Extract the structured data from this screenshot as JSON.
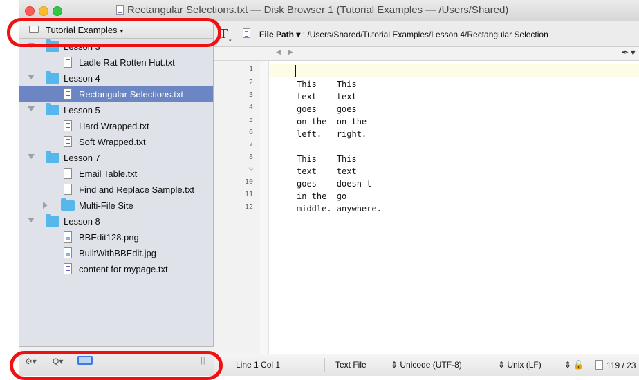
{
  "window": {
    "title": "Rectangular Selections.txt — Disk Browser 1 (Tutorial Examples — /Users/Shared)"
  },
  "sidebar": {
    "header_label": "Tutorial Examples",
    "caret": "▾",
    "tree": [
      {
        "label": "Lesson 3",
        "kind": "folder",
        "expanded": true
      },
      {
        "label": "Ladle Rat Rotten Hut.txt",
        "kind": "text-file"
      },
      {
        "label": "Lesson 4",
        "kind": "folder",
        "expanded": true
      },
      {
        "label": "Rectangular Selections.txt",
        "kind": "text-file",
        "selected": true
      },
      {
        "label": "Lesson 5",
        "kind": "folder",
        "expanded": true
      },
      {
        "label": "Hard Wrapped.txt",
        "kind": "text-file"
      },
      {
        "label": "Soft Wrapped.txt",
        "kind": "text-file"
      },
      {
        "label": "Lesson 7",
        "kind": "folder",
        "expanded": true
      },
      {
        "label": "Email Table.txt",
        "kind": "text-file"
      },
      {
        "label": "Find and Replace Sample.txt",
        "kind": "text-file"
      },
      {
        "label": "Multi-File Site",
        "kind": "folder",
        "expanded": false
      },
      {
        "label": "Lesson 8",
        "kind": "folder",
        "expanded": true
      },
      {
        "label": "BBEdit128.png",
        "kind": "image-file"
      },
      {
        "label": "BuiltWithBBEdit.jpg",
        "kind": "image-file"
      },
      {
        "label": "content for mypage.txt",
        "kind": "text-file"
      }
    ],
    "footer": {
      "gear": "⚙▾",
      "search": "Q▾",
      "grip": "|||"
    }
  },
  "toolbar": {
    "text_tool": "T",
    "path_label": "File Path ▾",
    "path_value": " : /Users/Shared/Tutorial Examples/Lesson 4/Rectangular Selection"
  },
  "navbar": {
    "prev": "◀",
    "next": "▶",
    "pen": "✒ ▾"
  },
  "editor": {
    "line_numbers": [
      "1",
      "2",
      "3",
      "4",
      "5",
      "6",
      "7",
      "8",
      "9",
      "10",
      "11",
      "12"
    ],
    "lines": [
      "",
      "This    This",
      "text    text",
      "goes    goes",
      "on the  on the",
      "left.   right.",
      "",
      "This    This",
      "text    text",
      "goes    doesn't",
      "in the  go",
      "middle. anywhere."
    ]
  },
  "status": {
    "position": "Line 1 Col 1",
    "language": "Text File",
    "encoding": "⇕ Unicode (UTF-8)",
    "line_endings": "⇕ Unix (LF)",
    "lock": "⇕ 🔓",
    "stats": "119 / 23 ."
  },
  "colors": {
    "selection": "#6b86c3",
    "folder": "#56b7ec",
    "marker": "#ee1111"
  }
}
